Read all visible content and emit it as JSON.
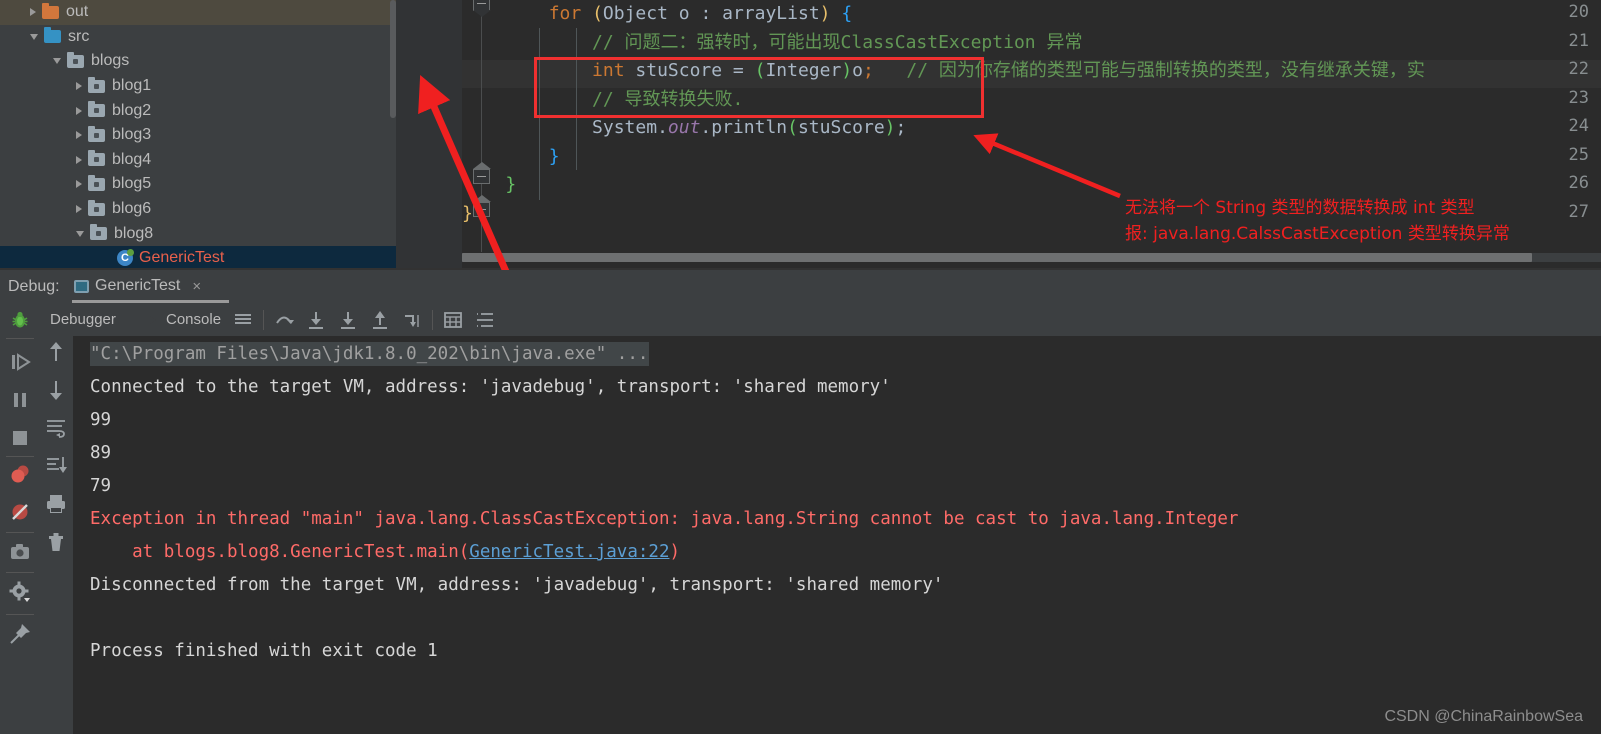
{
  "project_tree": {
    "items": [
      {
        "label": "out",
        "indent": 30,
        "arrow": "collapsed",
        "icon": "folder-orange",
        "state": "hover"
      },
      {
        "label": "src",
        "indent": 30,
        "arrow": "expanded",
        "icon": "folder-blue",
        "state": "normal"
      },
      {
        "label": "blogs",
        "indent": 53,
        "arrow": "expanded",
        "icon": "folder-package",
        "state": "normal"
      },
      {
        "label": "blog1",
        "indent": 76,
        "arrow": "collapsed",
        "icon": "folder-package",
        "state": "normal"
      },
      {
        "label": "blog2",
        "indent": 76,
        "arrow": "collapsed",
        "icon": "folder-package",
        "state": "normal"
      },
      {
        "label": "blog3",
        "indent": 76,
        "arrow": "collapsed",
        "icon": "folder-package",
        "state": "normal"
      },
      {
        "label": "blog4",
        "indent": 76,
        "arrow": "collapsed",
        "icon": "folder-package",
        "state": "normal"
      },
      {
        "label": "blog5",
        "indent": 76,
        "arrow": "collapsed",
        "icon": "folder-package",
        "state": "normal"
      },
      {
        "label": "blog6",
        "indent": 76,
        "arrow": "collapsed",
        "icon": "folder-package",
        "state": "normal"
      },
      {
        "label": "blog8",
        "indent": 76,
        "arrow": "expanded",
        "icon": "folder-package",
        "state": "normal"
      },
      {
        "label": "GenericTest",
        "indent": 105,
        "arrow": "none",
        "icon": "java-class",
        "state": "selected"
      }
    ]
  },
  "editor": {
    "line_numbers": [
      "20",
      "21",
      "22",
      "23",
      "24",
      "25",
      "26",
      "27"
    ],
    "lines": [
      {
        "n": "20",
        "segments": [
          {
            "t": "        ",
            "c": "tok-txt"
          },
          {
            "t": "for",
            "c": "tok-kw"
          },
          {
            "t": " ",
            "c": "tok-txt"
          },
          {
            "t": "(",
            "c": "tok-par"
          },
          {
            "t": "Object",
            "c": "tok-txt"
          },
          {
            "t": " o : arrayList",
            "c": "tok-txt"
          },
          {
            "t": ")",
            "c": "tok-par"
          },
          {
            "t": " ",
            "c": "tok-txt"
          },
          {
            "t": "{",
            "c": "tok-par2"
          }
        ]
      },
      {
        "n": "21",
        "segments": [
          {
            "t": "            // 问题二：强转时，可能出现ClassCastException 异常",
            "c": "tok-cmt"
          }
        ]
      },
      {
        "n": "22",
        "segments": [
          {
            "t": "            ",
            "c": "tok-txt"
          },
          {
            "t": "int",
            "c": "tok-kw"
          },
          {
            "t": " stuScore = ",
            "c": "tok-txt"
          },
          {
            "t": "(",
            "c": "tok-par3"
          },
          {
            "t": "Integer",
            "c": "tok-txt"
          },
          {
            "t": ")",
            "c": "tok-par3"
          },
          {
            "t": "o",
            "c": "tok-txt"
          },
          {
            "t": ";",
            "c": "tok-kw"
          },
          {
            "t": "   // 因为你存储的类型可能与强制转换的类型，没有继承关键，实",
            "c": "tok-cmt"
          }
        ]
      },
      {
        "n": "23",
        "segments": [
          {
            "t": "            // 导致转换失败.",
            "c": "tok-cmt"
          }
        ]
      },
      {
        "n": "24",
        "segments": [
          {
            "t": "            System.",
            "c": "tok-txt"
          },
          {
            "t": "out",
            "c": "tok-field"
          },
          {
            "t": ".println",
            "c": "tok-txt"
          },
          {
            "t": "(",
            "c": "tok-par3"
          },
          {
            "t": "stuScore",
            "c": "tok-txt"
          },
          {
            "t": ")",
            "c": "tok-par3"
          },
          {
            "t": ";",
            "c": "tok-txt"
          }
        ]
      },
      {
        "n": "25",
        "segments": [
          {
            "t": "        }",
            "c": "tok-par2"
          }
        ]
      },
      {
        "n": "26",
        "segments": [
          {
            "t": "    }",
            "c": "tok-par3"
          }
        ]
      },
      {
        "n": "27",
        "segments": [
          {
            "t": "}",
            "c": "tok-par"
          }
        ]
      }
    ]
  },
  "annotations": {
    "right_text_line1": "无法将一个 String 类型的数据转换成 int 类型",
    "right_text_line2": "报: java.lang.CalssCastException 类型转换异常",
    "box_color": "#f03030",
    "arrow_color": "#f02020"
  },
  "debug": {
    "label": "Debug:",
    "tab_name": "GenericTest",
    "tab_close": "×",
    "toolbar": {
      "debugger_tab": "Debugger",
      "console_tab": "Console"
    }
  },
  "console": {
    "lines": [
      {
        "text": "\"C:\\Program Files\\Java\\jdk1.8.0_202\\bin\\java.exe\" ...",
        "color": "c-grey",
        "highlight": true
      },
      {
        "text": "Connected to the target VM, address: 'javadebug', transport: 'shared memory'",
        "color": "c-white"
      },
      {
        "text": "99",
        "color": "c-white"
      },
      {
        "text": "89",
        "color": "c-white"
      },
      {
        "text": "79",
        "color": "c-white"
      },
      {
        "text": "Exception in thread \"main\" java.lang.ClassCastException: java.lang.String cannot be cast to java.lang.Integer",
        "color": "c-red"
      },
      {
        "text": "    at blogs.blog8.GenericTest.main(",
        "link": "GenericTest.java:22",
        "suffix": ")",
        "color": "c-red"
      },
      {
        "text": "Disconnected from the target VM, address: 'javadebug', transport: 'shared memory'",
        "color": "c-white"
      },
      {
        "text": "",
        "color": "c-white"
      },
      {
        "text": "Process finished with exit code 1",
        "color": "c-white"
      }
    ]
  },
  "watermark": "CSDN @ChinaRainbowSea"
}
